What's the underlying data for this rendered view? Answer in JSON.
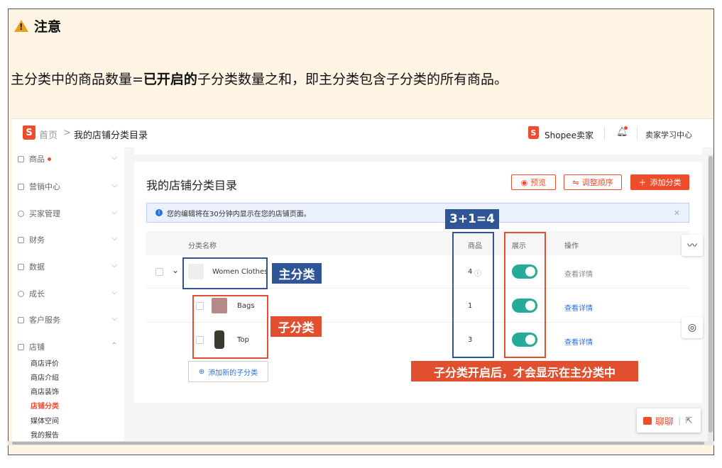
{
  "note": {
    "title": "注意",
    "text_prefix": "主分类中的商品数量=",
    "text_bold": "已开启的",
    "text_suffix": "子分类数量之和，即主分类包含子分类的所有商品。"
  },
  "topbar": {
    "home": "首页",
    "separator": ">",
    "current": "我的店铺分类目录",
    "brand": "Shopee卖家",
    "learning": "卖家学习中心",
    "logo_letter": "S"
  },
  "sidebar": {
    "items": [
      {
        "label": "商品",
        "icon": "box-icon",
        "badge": true
      },
      {
        "label": "营销中心",
        "icon": "tag-icon"
      },
      {
        "label": "买家管理",
        "icon": "user-icon"
      },
      {
        "label": "财务",
        "icon": "wallet-icon"
      },
      {
        "label": "数据",
        "icon": "chart-icon"
      },
      {
        "label": "成长",
        "icon": "growth-icon"
      },
      {
        "label": "客户服务",
        "icon": "chat-icon"
      },
      {
        "label": "店铺",
        "icon": "store-icon"
      }
    ],
    "sub_items": [
      "商店评价",
      "商店介绍",
      "商店装饰",
      "店铺分类",
      "媒体空间",
      "我的报告"
    ],
    "active_sub": "店铺分类"
  },
  "main": {
    "heading": "我的店铺分类目录",
    "preview_btn": "预览",
    "reorder_btn": "调整顺序",
    "add_btn": "添加分类",
    "info_text": "您的编辑将在30分钟内显示在您的店铺页面。",
    "table": {
      "headers": {
        "name": "分类名称",
        "products": "商品",
        "display": "展示",
        "action": "操作"
      },
      "rows": [
        {
          "name": "Women Clothes",
          "count": "4",
          "action": "查看详情",
          "enabled": true
        },
        {
          "name": "Bags",
          "count": "1",
          "action": "查看详情",
          "enabled": true
        },
        {
          "name": "Top",
          "count": "3",
          "action": "查看详情",
          "enabled": true
        }
      ]
    },
    "add_sub": "添加新的子分类"
  },
  "annotations": {
    "main_category": "主分类",
    "sub_category": "子分类",
    "sum": "3+1=4",
    "note": "子分类开启后，才会显示在主分类中"
  },
  "chat_label": "聊聊",
  "colors": {
    "brand": "#ee4d2d",
    "toggle_on": "#26aa99",
    "annotation_blue": "#2f5597",
    "annotation_red": "#e0502f",
    "link": "#2673dd"
  }
}
